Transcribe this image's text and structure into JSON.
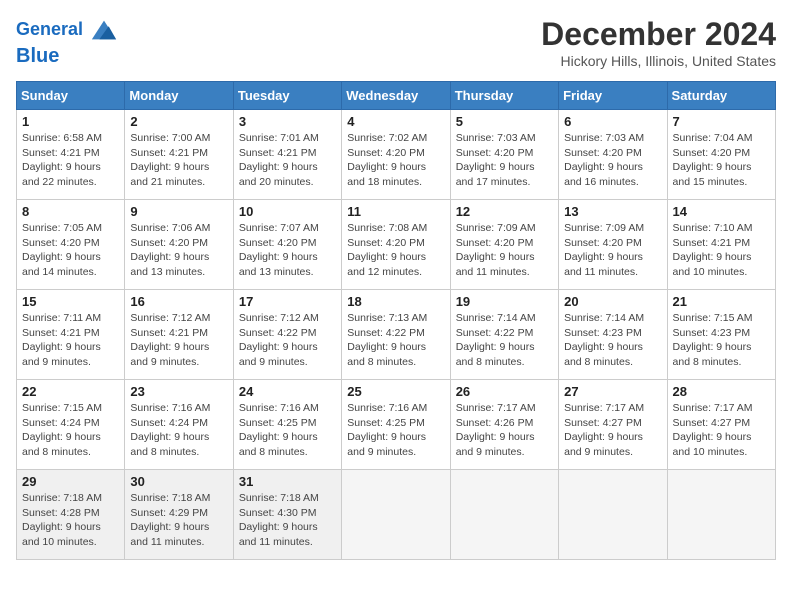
{
  "header": {
    "logo_line1": "General",
    "logo_line2": "Blue",
    "month_title": "December 2024",
    "location": "Hickory Hills, Illinois, United States"
  },
  "days_of_week": [
    "Sunday",
    "Monday",
    "Tuesday",
    "Wednesday",
    "Thursday",
    "Friday",
    "Saturday"
  ],
  "weeks": [
    [
      {
        "day": "1",
        "sunrise": "6:58 AM",
        "sunset": "4:21 PM",
        "daylight": "9 hours and 22 minutes."
      },
      {
        "day": "2",
        "sunrise": "7:00 AM",
        "sunset": "4:21 PM",
        "daylight": "9 hours and 21 minutes."
      },
      {
        "day": "3",
        "sunrise": "7:01 AM",
        "sunset": "4:21 PM",
        "daylight": "9 hours and 20 minutes."
      },
      {
        "day": "4",
        "sunrise": "7:02 AM",
        "sunset": "4:20 PM",
        "daylight": "9 hours and 18 minutes."
      },
      {
        "day": "5",
        "sunrise": "7:03 AM",
        "sunset": "4:20 PM",
        "daylight": "9 hours and 17 minutes."
      },
      {
        "day": "6",
        "sunrise": "7:03 AM",
        "sunset": "4:20 PM",
        "daylight": "9 hours and 16 minutes."
      },
      {
        "day": "7",
        "sunrise": "7:04 AM",
        "sunset": "4:20 PM",
        "daylight": "9 hours and 15 minutes."
      }
    ],
    [
      {
        "day": "8",
        "sunrise": "7:05 AM",
        "sunset": "4:20 PM",
        "daylight": "9 hours and 14 minutes."
      },
      {
        "day": "9",
        "sunrise": "7:06 AM",
        "sunset": "4:20 PM",
        "daylight": "9 hours and 13 minutes."
      },
      {
        "day": "10",
        "sunrise": "7:07 AM",
        "sunset": "4:20 PM",
        "daylight": "9 hours and 13 minutes."
      },
      {
        "day": "11",
        "sunrise": "7:08 AM",
        "sunset": "4:20 PM",
        "daylight": "9 hours and 12 minutes."
      },
      {
        "day": "12",
        "sunrise": "7:09 AM",
        "sunset": "4:20 PM",
        "daylight": "9 hours and 11 minutes."
      },
      {
        "day": "13",
        "sunrise": "7:09 AM",
        "sunset": "4:20 PM",
        "daylight": "9 hours and 11 minutes."
      },
      {
        "day": "14",
        "sunrise": "7:10 AM",
        "sunset": "4:21 PM",
        "daylight": "9 hours and 10 minutes."
      }
    ],
    [
      {
        "day": "15",
        "sunrise": "7:11 AM",
        "sunset": "4:21 PM",
        "daylight": "9 hours and 9 minutes."
      },
      {
        "day": "16",
        "sunrise": "7:12 AM",
        "sunset": "4:21 PM",
        "daylight": "9 hours and 9 minutes."
      },
      {
        "day": "17",
        "sunrise": "7:12 AM",
        "sunset": "4:22 PM",
        "daylight": "9 hours and 9 minutes."
      },
      {
        "day": "18",
        "sunrise": "7:13 AM",
        "sunset": "4:22 PM",
        "daylight": "9 hours and 8 minutes."
      },
      {
        "day": "19",
        "sunrise": "7:14 AM",
        "sunset": "4:22 PM",
        "daylight": "9 hours and 8 minutes."
      },
      {
        "day": "20",
        "sunrise": "7:14 AM",
        "sunset": "4:23 PM",
        "daylight": "9 hours and 8 minutes."
      },
      {
        "day": "21",
        "sunrise": "7:15 AM",
        "sunset": "4:23 PM",
        "daylight": "9 hours and 8 minutes."
      }
    ],
    [
      {
        "day": "22",
        "sunrise": "7:15 AM",
        "sunset": "4:24 PM",
        "daylight": "9 hours and 8 minutes."
      },
      {
        "day": "23",
        "sunrise": "7:16 AM",
        "sunset": "4:24 PM",
        "daylight": "9 hours and 8 minutes."
      },
      {
        "day": "24",
        "sunrise": "7:16 AM",
        "sunset": "4:25 PM",
        "daylight": "9 hours and 8 minutes."
      },
      {
        "day": "25",
        "sunrise": "7:16 AM",
        "sunset": "4:25 PM",
        "daylight": "9 hours and 9 minutes."
      },
      {
        "day": "26",
        "sunrise": "7:17 AM",
        "sunset": "4:26 PM",
        "daylight": "9 hours and 9 minutes."
      },
      {
        "day": "27",
        "sunrise": "7:17 AM",
        "sunset": "4:27 PM",
        "daylight": "9 hours and 9 minutes."
      },
      {
        "day": "28",
        "sunrise": "7:17 AM",
        "sunset": "4:27 PM",
        "daylight": "9 hours and 10 minutes."
      }
    ],
    [
      {
        "day": "29",
        "sunrise": "7:18 AM",
        "sunset": "4:28 PM",
        "daylight": "9 hours and 10 minutes."
      },
      {
        "day": "30",
        "sunrise": "7:18 AM",
        "sunset": "4:29 PM",
        "daylight": "9 hours and 11 minutes."
      },
      {
        "day": "31",
        "sunrise": "7:18 AM",
        "sunset": "4:30 PM",
        "daylight": "9 hours and 11 minutes."
      },
      null,
      null,
      null,
      null
    ]
  ],
  "labels": {
    "sunrise": "Sunrise:",
    "sunset": "Sunset:",
    "daylight": "Daylight:"
  }
}
